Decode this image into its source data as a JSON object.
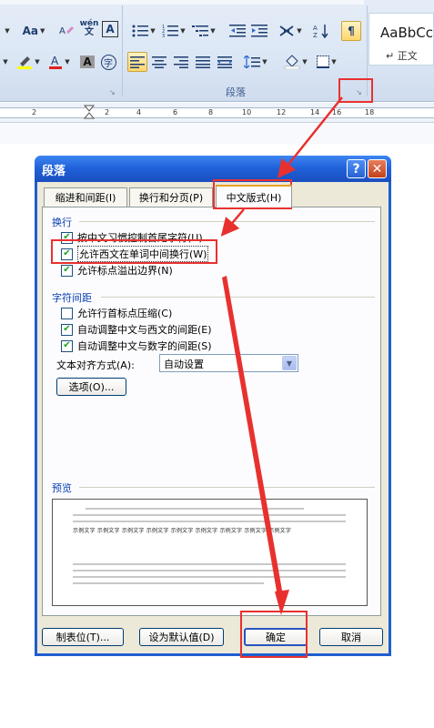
{
  "ribbon": {
    "font_size_label": "Aa",
    "wen_label": "wén",
    "bordered_char": "A",
    "active_button": "¶",
    "styles_sample": "AaBbCc",
    "style_name": "↵ 正文",
    "paragraph_group_label": "段落",
    "font_color": "#e02020"
  },
  "ruler": {
    "numbers": [
      "2",
      "2",
      "4",
      "6",
      "8",
      "10",
      "12",
      "14",
      "16",
      "18"
    ]
  },
  "dialog": {
    "title": "段落",
    "help_glyph": "?",
    "close_glyph": "✕",
    "tabs": [
      {
        "label": "缩进和间距(I)"
      },
      {
        "label": "换行和分页(P)"
      },
      {
        "label": "中文版式(H)"
      }
    ],
    "section_wrap": "换行",
    "wrap_options": [
      {
        "label": "按中文习惯控制首尾字符(U)",
        "checked": true
      },
      {
        "label": "允许西文在单词中间换行(W)",
        "checked": true
      },
      {
        "label": "允许标点溢出边界(N)",
        "checked": true
      }
    ],
    "section_spacing": "字符间距",
    "spacing_options": [
      {
        "label": "允许行首标点压缩(C)",
        "checked": false
      },
      {
        "label": "自动调整中文与西文的间距(E)",
        "checked": true
      },
      {
        "label": "自动调整中文与数字的间距(S)",
        "checked": true
      }
    ],
    "alignment_label": "文本对齐方式(A):",
    "alignment_value": "自动设置",
    "options_button": "选项(O)...",
    "section_preview": "预览",
    "preview_text": "示例文字 示例文字 示例文字 示例文字 示例文字 示例文字 示例文字 示例文字 示例文字",
    "buttons": {
      "tabs": "制表位(T)...",
      "default": "设为默认值(D)",
      "ok": "确定",
      "cancel": "取消"
    }
  },
  "colors": {
    "annotation": "#e8312f",
    "title_bar": "#1f5fd8",
    "dialog_face": "#ece9d8",
    "check": "#21a121"
  }
}
